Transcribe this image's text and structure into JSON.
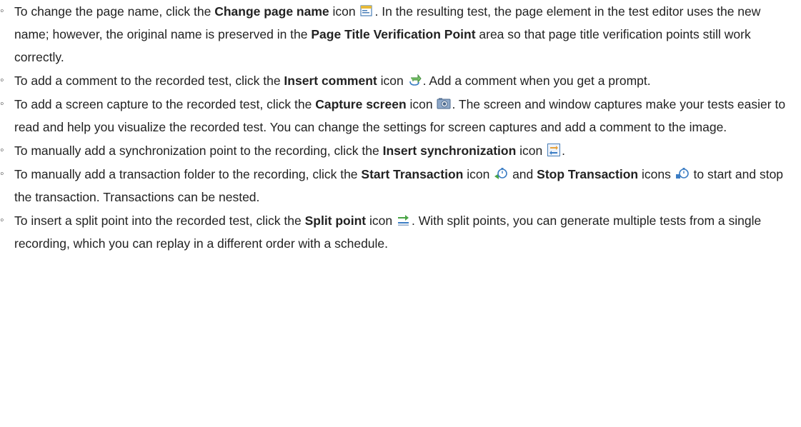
{
  "items": [
    {
      "prefix": "To change the page name, click the ",
      "bold": "Change page name",
      "middle": " icon ",
      "icon": "change-page-name-icon",
      "suffix": ". In the resulting test, the page element in the test editor uses the new name; however, the original name is preserved in the ",
      "bold2": "Page Title Verification Point",
      "suffix2": " area so that page title verification points still work correctly."
    },
    {
      "prefix": "To add a comment to the recorded test, click the ",
      "bold": "Insert comment",
      "middle": " icon ",
      "icon": "insert-comment-icon",
      "suffix": ". Add a comment when you get a prompt."
    },
    {
      "prefix": "To add a screen capture to the recorded test, click the ",
      "bold": "Capture screen",
      "middle": " icon ",
      "icon": "capture-screen-icon",
      "suffix": ". The screen and window captures make your tests easier to read and help you visualize the recorded test. You can change the settings for screen captures and add a comment to the image."
    },
    {
      "prefix": "To manually add a synchronization point to the recording, click the ",
      "bold": "Insert synchronization",
      "middle": " icon ",
      "icon": "insert-synchronization-icon",
      "suffix": "."
    },
    {
      "prefix": "To manually add a transaction folder to the recording, click the ",
      "bold": "Start Transaction",
      "middle": " icon ",
      "icon": "start-transaction-icon",
      "mid2": " and ",
      "bold2": "Stop Transaction",
      "mid3": " icons ",
      "icon2": "stop-transaction-icon",
      "suffix": " to start and stop the transaction. Transactions can be nested."
    },
    {
      "prefix": "To insert a split point into the recorded test, click the  ",
      "bold": "Split point",
      "middle": " icon ",
      "icon": "split-point-icon",
      "suffix": ". With split points, you can generate multiple tests from a single recording, which you can replay in a different order with a schedule."
    }
  ],
  "bullet_char": "◦",
  "colors": {
    "text": "#222222",
    "icon_blue": "#3b7dc4",
    "icon_green": "#4aa546",
    "icon_yellow": "#e6b93a"
  }
}
